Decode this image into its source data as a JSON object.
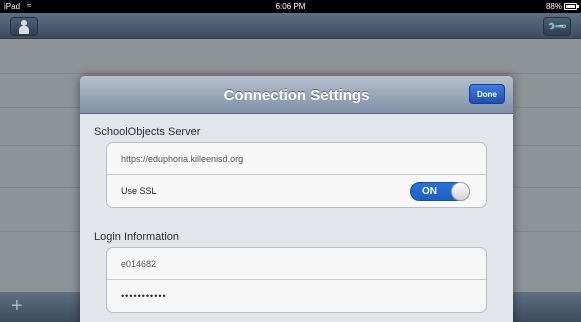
{
  "status_bar": {
    "device": "iPad",
    "wifi_icon": "wifi-icon",
    "time": "6:06 PM",
    "battery": "88%"
  },
  "nav_bar": {
    "left_icon": "person-icon",
    "right_icon": "wrench-icon"
  },
  "toolbar": {
    "add_icon": "+"
  },
  "modal": {
    "title": "Connection Settings",
    "done_label": "Done",
    "server_section": {
      "heading": "SchoolObjects Server",
      "server_url": "https://eduphoria.killeenisd.org",
      "ssl_label": "Use SSL",
      "ssl_state": "ON"
    },
    "login_section": {
      "heading": "Login Information",
      "username": "e014682",
      "password_masked": "•••••••••••"
    }
  },
  "colors": {
    "accent": "#2a72d9",
    "nav_bar": "#4d5d72",
    "dim_background": "#8f9499"
  }
}
